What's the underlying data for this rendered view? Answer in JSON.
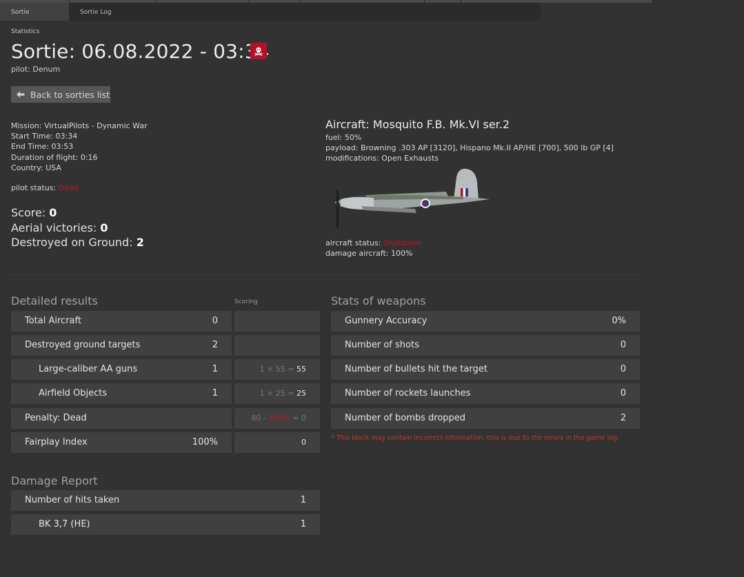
{
  "tabs": [
    {
      "label": "Sortie Statistics",
      "active": true
    },
    {
      "label": "Sortie Log",
      "active": false
    }
  ],
  "header": {
    "title": "Sortie: 06.08.2022 - 03:34",
    "status_icon": "skull-icon",
    "pilot_label": "pilot:",
    "pilot_name": "Denum",
    "back_label": "Back to sorties list"
  },
  "mission": {
    "mission": "Mission: VirtualPilots - Dynamic War",
    "start": "Start Time: 03:34",
    "end": "End Time: 03:53",
    "duration": "Duration of flight: 0:16",
    "country": "Country: USA",
    "pilot_status_label": "pilot status:",
    "pilot_status_value": "Dead"
  },
  "score": {
    "score_label": "Score:",
    "score_value": "0",
    "aerial_label": "Aerial victories:",
    "aerial_value": "0",
    "ground_label": "Destroyed on Ground:",
    "ground_value": "2"
  },
  "aircraft": {
    "title": "Aircraft: Mosquito F.B. Mk.VI ser.2",
    "fuel": "fuel: 50%",
    "payload": "payload: Browning .303 AP [3120], Hispano Mk.II AP/HE [700], 500 lb GP [4]",
    "modifications": "modifications: Open Exhausts",
    "status_label": "aircraft status:",
    "status_value": "Shotdown",
    "damage": "damage aircraft: 100%"
  },
  "detailed": {
    "title": "Detailed results",
    "scoring_header": "Scoring",
    "rows": [
      {
        "label": "Total Aircraft",
        "value": "0"
      },
      {
        "label": "Destroyed ground targets",
        "value": "2"
      },
      {
        "label": "Large-caliber AA guns",
        "value": "1",
        "calc": "1 × 55 =",
        "result": "55"
      },
      {
        "label": "Airfield Objects",
        "value": "1",
        "calc": "1 × 25 =",
        "result": "25"
      },
      {
        "label": "Penalty: Dead",
        "calc_a": "80 -",
        "calc_pct": "100%",
        "calc_b": "= 0"
      },
      {
        "label": "Fairplay Index",
        "value": "100%",
        "result": "0"
      }
    ]
  },
  "weapons": {
    "title": "Stats of weapons",
    "rows": [
      {
        "label": "Gunnery Accuracy",
        "value": "0%"
      },
      {
        "label": "Number of shots",
        "value": "0"
      },
      {
        "label": "Number of bullets hit the target",
        "value": "0"
      },
      {
        "label": "Number of rockets launches",
        "value": "0"
      },
      {
        "label": "Number of bombs dropped",
        "value": "2"
      }
    ],
    "note": "* This block may contain incorrect information, this is due to the errors in the game log."
  },
  "damage_report": {
    "title": "Damage Report",
    "rows": [
      {
        "label": "Number of hits taken",
        "value": "1"
      },
      {
        "label": "BK 3,7 (HE)",
        "value": "1"
      }
    ]
  },
  "colors": {
    "background": "#323232",
    "row": "#404040",
    "accent_red": "#c01525",
    "badge_red": "#b3102a"
  }
}
